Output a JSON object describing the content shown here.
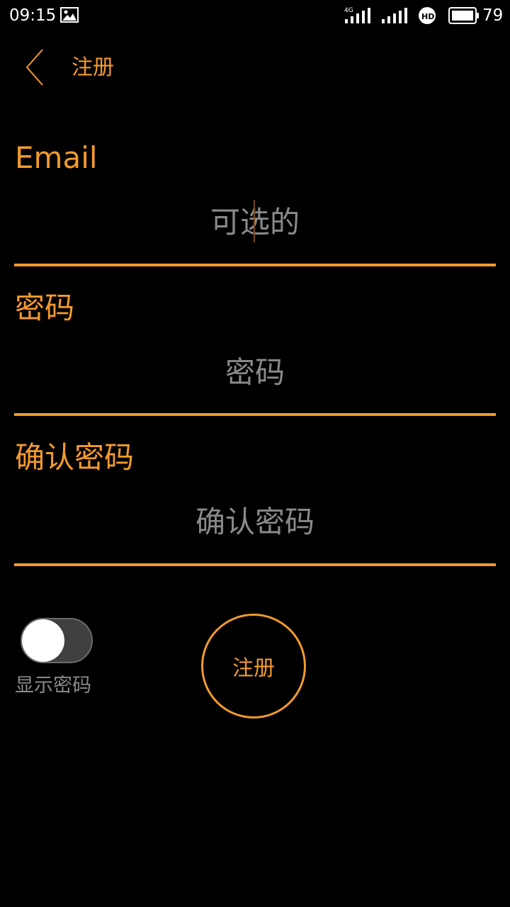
{
  "status_bar": {
    "time": "09:15",
    "battery_level": "79",
    "icons": [
      "image-icon",
      "4g-signal-icon",
      "signal-icon",
      "hd-icon",
      "battery-icon"
    ]
  },
  "toolbar": {
    "title": "注册",
    "back_icon": "chevron-left-icon"
  },
  "form": {
    "email": {
      "label": "Email",
      "placeholder": "可选的"
    },
    "password": {
      "label": "密码",
      "placeholder": "密码"
    },
    "confirm_password": {
      "label": "确认密码",
      "placeholder": "确认密码"
    }
  },
  "show_password": {
    "label": "显示密码",
    "enabled": false
  },
  "register_button": {
    "label": "注册"
  },
  "colors": {
    "accent": "#f29a2e",
    "background": "#000000",
    "placeholder": "#8a8a8a",
    "toggle_track": "#404040"
  }
}
